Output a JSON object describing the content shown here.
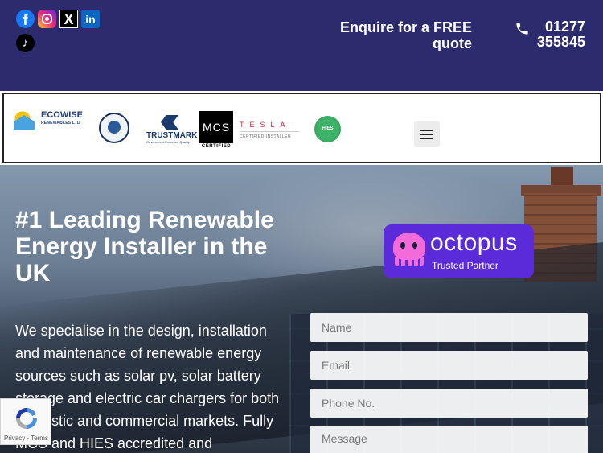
{
  "header": {
    "social": [
      "facebook-icon",
      "instagram-icon",
      "x-icon",
      "linkedin-icon",
      "tiktok-icon"
    ],
    "social_glyphs": {
      "facebook": "f",
      "x": "X",
      "linkedin": "in",
      "tiktok": "♪"
    },
    "enquire_line1": "Enquire for a FREE",
    "enquire_line2": "quote",
    "phone_line1": "01277",
    "phone_line2": "355845",
    "colors": {
      "background": "#2b2b6e",
      "text": "#ffffff"
    }
  },
  "logos": {
    "ecowise_name": "ECOWISE",
    "ecowise_sub": "RENEWABLES LTD",
    "trustmark_name": "TRUSTMARK",
    "trustmark_sub": "Government Endorsed Quality",
    "mcs_name": "MCS",
    "mcs_cert": "CERTIFIED",
    "tesla_name": "TESLA",
    "tesla_sub": "CERTIFIED INSTALLER",
    "hies_name": "HIES"
  },
  "hero": {
    "title": "#1 Leading Renewable Energy Installer in the UK",
    "text": "We specialise in the design, installation and maintenance of renewable energy sources such as solar pv, solar battery storage and electric car chargers for both domestic and commercial markets. Fully MCS and HIES accredited and",
    "octopus_name": "octopus",
    "octopus_sub": "Trusted Partner"
  },
  "form": {
    "name_placeholder": "Name",
    "email_placeholder": "Email",
    "phone_placeholder": "Phone No.",
    "message_placeholder": "Message"
  },
  "recaptcha": {
    "text": "Privacy - Terms"
  }
}
